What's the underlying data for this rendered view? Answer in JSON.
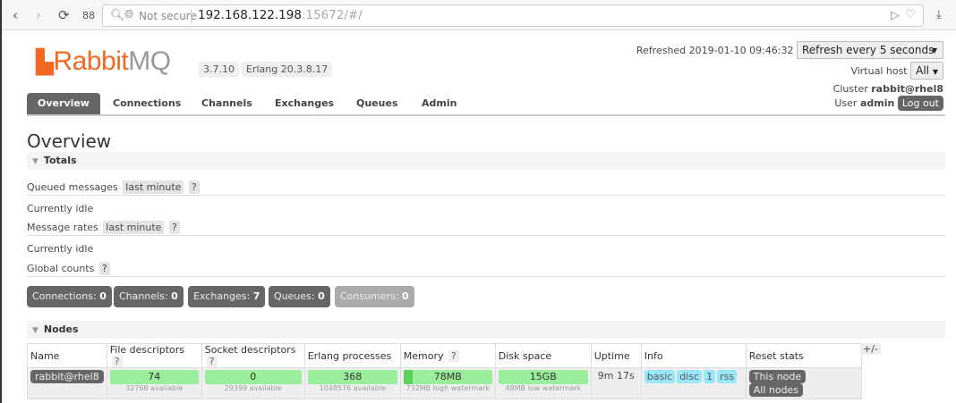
{
  "browser": {
    "not_secure": "Not secure",
    "url_host": "192.168.122.198",
    "url_rest": ":15672/#/"
  },
  "logo": {
    "rabbit": "Rabbit",
    "mq": "MQ"
  },
  "version": "3.7.10",
  "erlang": "Erlang 20.3.8.17",
  "tabs": [
    "Overview",
    "Connections",
    "Channels",
    "Exchanges",
    "Queues",
    "Admin"
  ],
  "header": {
    "refreshed": "Refreshed 2019-01-10 09:46:32",
    "refresh_select": "Refresh every 5 seconds",
    "vhost_label": "Virtual host",
    "vhost_value": "All",
    "cluster_label": "Cluster",
    "cluster": "rabbit@rhel8",
    "user_label": "User",
    "user": "admin",
    "logout": "Log out"
  },
  "title": "Overview",
  "totals": {
    "heading": "Totals",
    "queued": "Queued messages",
    "rates": "Message rates",
    "range": "last minute",
    "help": "?",
    "idle": "Currently idle",
    "global": "Global counts"
  },
  "counts": [
    {
      "label": "Connections:",
      "value": "0"
    },
    {
      "label": "Channels:",
      "value": "0"
    },
    {
      "label": "Exchanges:",
      "value": "7"
    },
    {
      "label": "Queues:",
      "value": "0"
    },
    {
      "label": "Consumers:",
      "value": "0"
    }
  ],
  "nodes": {
    "heading": "Nodes",
    "columns": [
      "Name",
      "File descriptors",
      "Socket descriptors",
      "Erlang processes",
      "Memory",
      "Disk space",
      "Uptime",
      "Info",
      "Reset stats"
    ],
    "toggle": "+/-",
    "row": {
      "name": "rabbit@rhel8",
      "fd": "74",
      "fd_sub": "32768 available",
      "sd": "0",
      "sd_sub": "29399 available",
      "ep": "368",
      "ep_sub": "1048576 available",
      "mem": "78MB",
      "mem_sub": "732MB high watermark",
      "disk": "15GB",
      "disk_sub": "48MB low watermark",
      "uptime": "9m 17s",
      "info": [
        "basic",
        "disc",
        "1",
        "rss"
      ],
      "reset": [
        "This node",
        "All nodes"
      ]
    }
  }
}
